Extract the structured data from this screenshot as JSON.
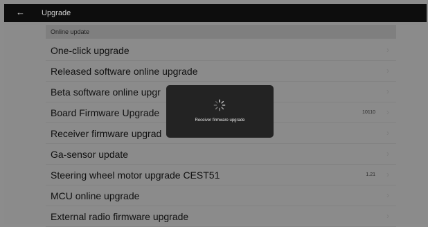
{
  "header": {
    "back_icon": "←",
    "title": "Upgrade"
  },
  "section": {
    "label": "Online update"
  },
  "items": [
    {
      "label": "One-click upgrade",
      "value": "",
      "chevron": "›"
    },
    {
      "label": "Released software online upgrade",
      "value": "",
      "chevron": "›"
    },
    {
      "label": "Beta software online upgr",
      "value": "",
      "chevron": "›"
    },
    {
      "label": "Board Firmware Upgrade",
      "value": "10110",
      "chevron": "›"
    },
    {
      "label": "Receiver firmware upgrad",
      "value": "",
      "chevron": "›"
    },
    {
      "label": "Ga-sensor update",
      "value": "",
      "chevron": "›"
    },
    {
      "label": "Steering wheel motor upgrade CEST51",
      "value": "1.21",
      "chevron": "›"
    },
    {
      "label": "MCU online upgrade",
      "value": "",
      "chevron": "›"
    },
    {
      "label": "External radio firmware upgrade",
      "value": "",
      "chevron": "›"
    }
  ],
  "dialog": {
    "icon": "loading-spinner-icon",
    "text": "Receiver firmware upgrade"
  }
}
